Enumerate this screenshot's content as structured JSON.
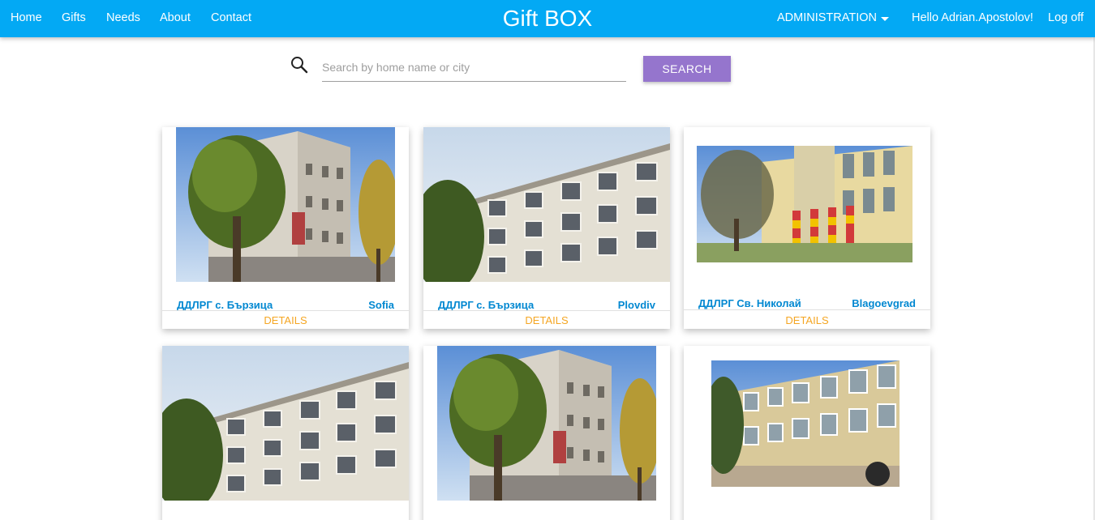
{
  "nav": {
    "home": "Home",
    "gifts": "Gifts",
    "needs": "Needs",
    "about": "About",
    "contact": "Contact",
    "brand": "Gift BOX",
    "administration": "ADMINISTRATION",
    "greeting": "Hello Adrian.Apostolov!",
    "logoff": "Log off"
  },
  "search": {
    "placeholder": "Search by home name or city",
    "button": "SEARCH"
  },
  "cards": [
    {
      "name": "ДДЛРГ с. Бързица",
      "city": "Sofia",
      "details": "DETAILS",
      "image": "building-tall-tree"
    },
    {
      "name": "ДДЛРГ с. Бързица",
      "city": "Plovdiv",
      "details": "DETAILS",
      "image": "building-wide"
    },
    {
      "name": "ДДЛРГ Св. Николай",
      "city": "Blagoevgrad",
      "details": "DETAILS",
      "image": "building-striped"
    },
    {
      "name": "",
      "city": "",
      "details": "",
      "image": "building-wide"
    },
    {
      "name": "",
      "city": "",
      "details": "",
      "image": "building-tall-tree"
    },
    {
      "name": "",
      "city": "",
      "details": "",
      "image": "building-yellow"
    }
  ],
  "colors": {
    "navbar": "#03a9f4",
    "search_button": "#9575cd",
    "card_title": "#0288d1",
    "details_link": "#f5a623"
  }
}
